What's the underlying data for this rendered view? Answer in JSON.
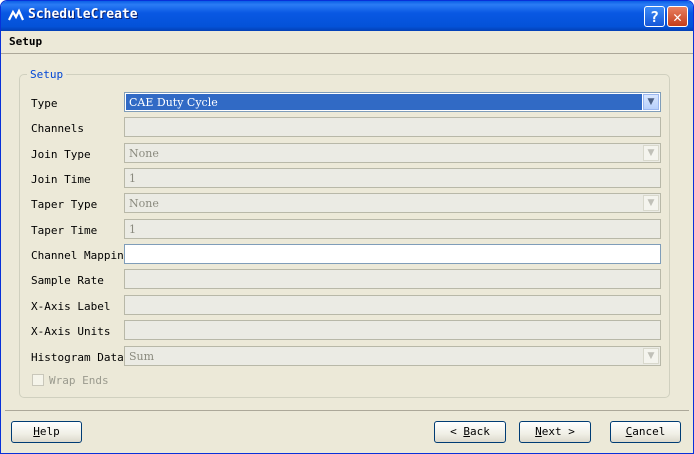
{
  "window": {
    "title": "ScheduleCreate"
  },
  "header": {
    "title": "Setup"
  },
  "group": {
    "legend": "Setup"
  },
  "fields": [
    {
      "label": "Type",
      "value": "CAE Duty Cycle"
    },
    {
      "label": "Channels",
      "value": ""
    },
    {
      "label": "Join Type",
      "value": "None"
    },
    {
      "label": "Join Time",
      "value": "1"
    },
    {
      "label": "Taper Type",
      "value": "None"
    },
    {
      "label": "Taper Time",
      "value": "1"
    },
    {
      "label": "Channel Mapping",
      "value": ""
    },
    {
      "label": "Sample Rate",
      "value": ""
    },
    {
      "label": "X-Axis Label",
      "value": ""
    },
    {
      "label": "X-Axis Units",
      "value": ""
    },
    {
      "label": "Histogram Data",
      "value": "Sum"
    }
  ],
  "wrap_ends": {
    "label": "Wrap Ends",
    "checked": false
  },
  "buttons": {
    "help_pre": "",
    "help_key": "H",
    "help_post": "elp",
    "back_pre": "< ",
    "back_key": "B",
    "back_post": "ack",
    "next_pre": "",
    "next_key": "N",
    "next_post": "ext >",
    "cancel_pre": "",
    "cancel_key": "C",
    "cancel_post": "ancel"
  }
}
